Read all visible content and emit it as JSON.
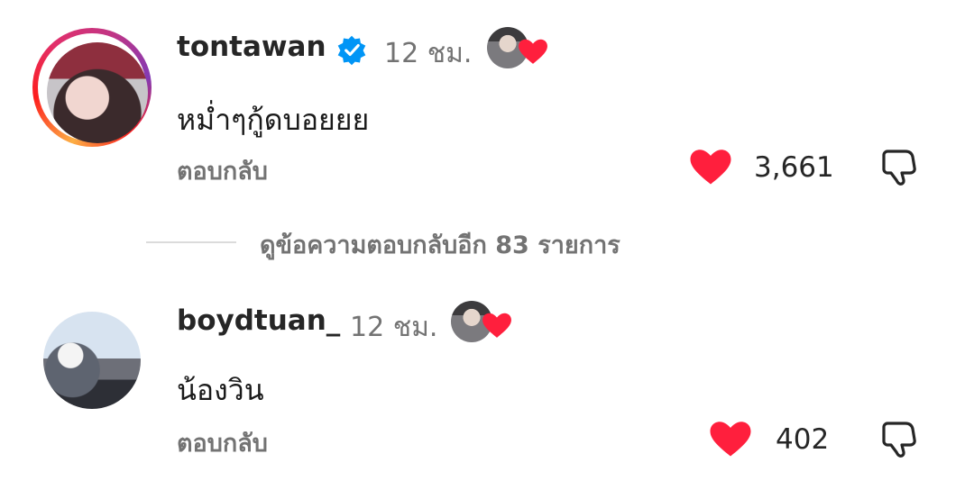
{
  "colors": {
    "like_heart": "#ff1f3d",
    "verified": "#0095f6",
    "muted": "#737373"
  },
  "comments": [
    {
      "username": "tontawan",
      "verified": true,
      "time": "12 ชม.",
      "text": "หม่ำๆกู้ดบอยยย",
      "reply_label": "ตอบกลับ",
      "like_count": "3,661",
      "liked": true,
      "creator_liked": true
    },
    {
      "username": "boydtuan_",
      "verified": false,
      "time": "12 ชม.",
      "text": "น้องวิน",
      "reply_label": "ตอบกลับ",
      "like_count": "402",
      "liked": true,
      "creator_liked": true
    }
  ],
  "view_replies": "ดูข้อความตอบกลับอีก 83 รายการ",
  "icons": {
    "verified": "verified-badge-icon",
    "heart": "heart-icon",
    "dislike": "thumbs-down-icon"
  }
}
